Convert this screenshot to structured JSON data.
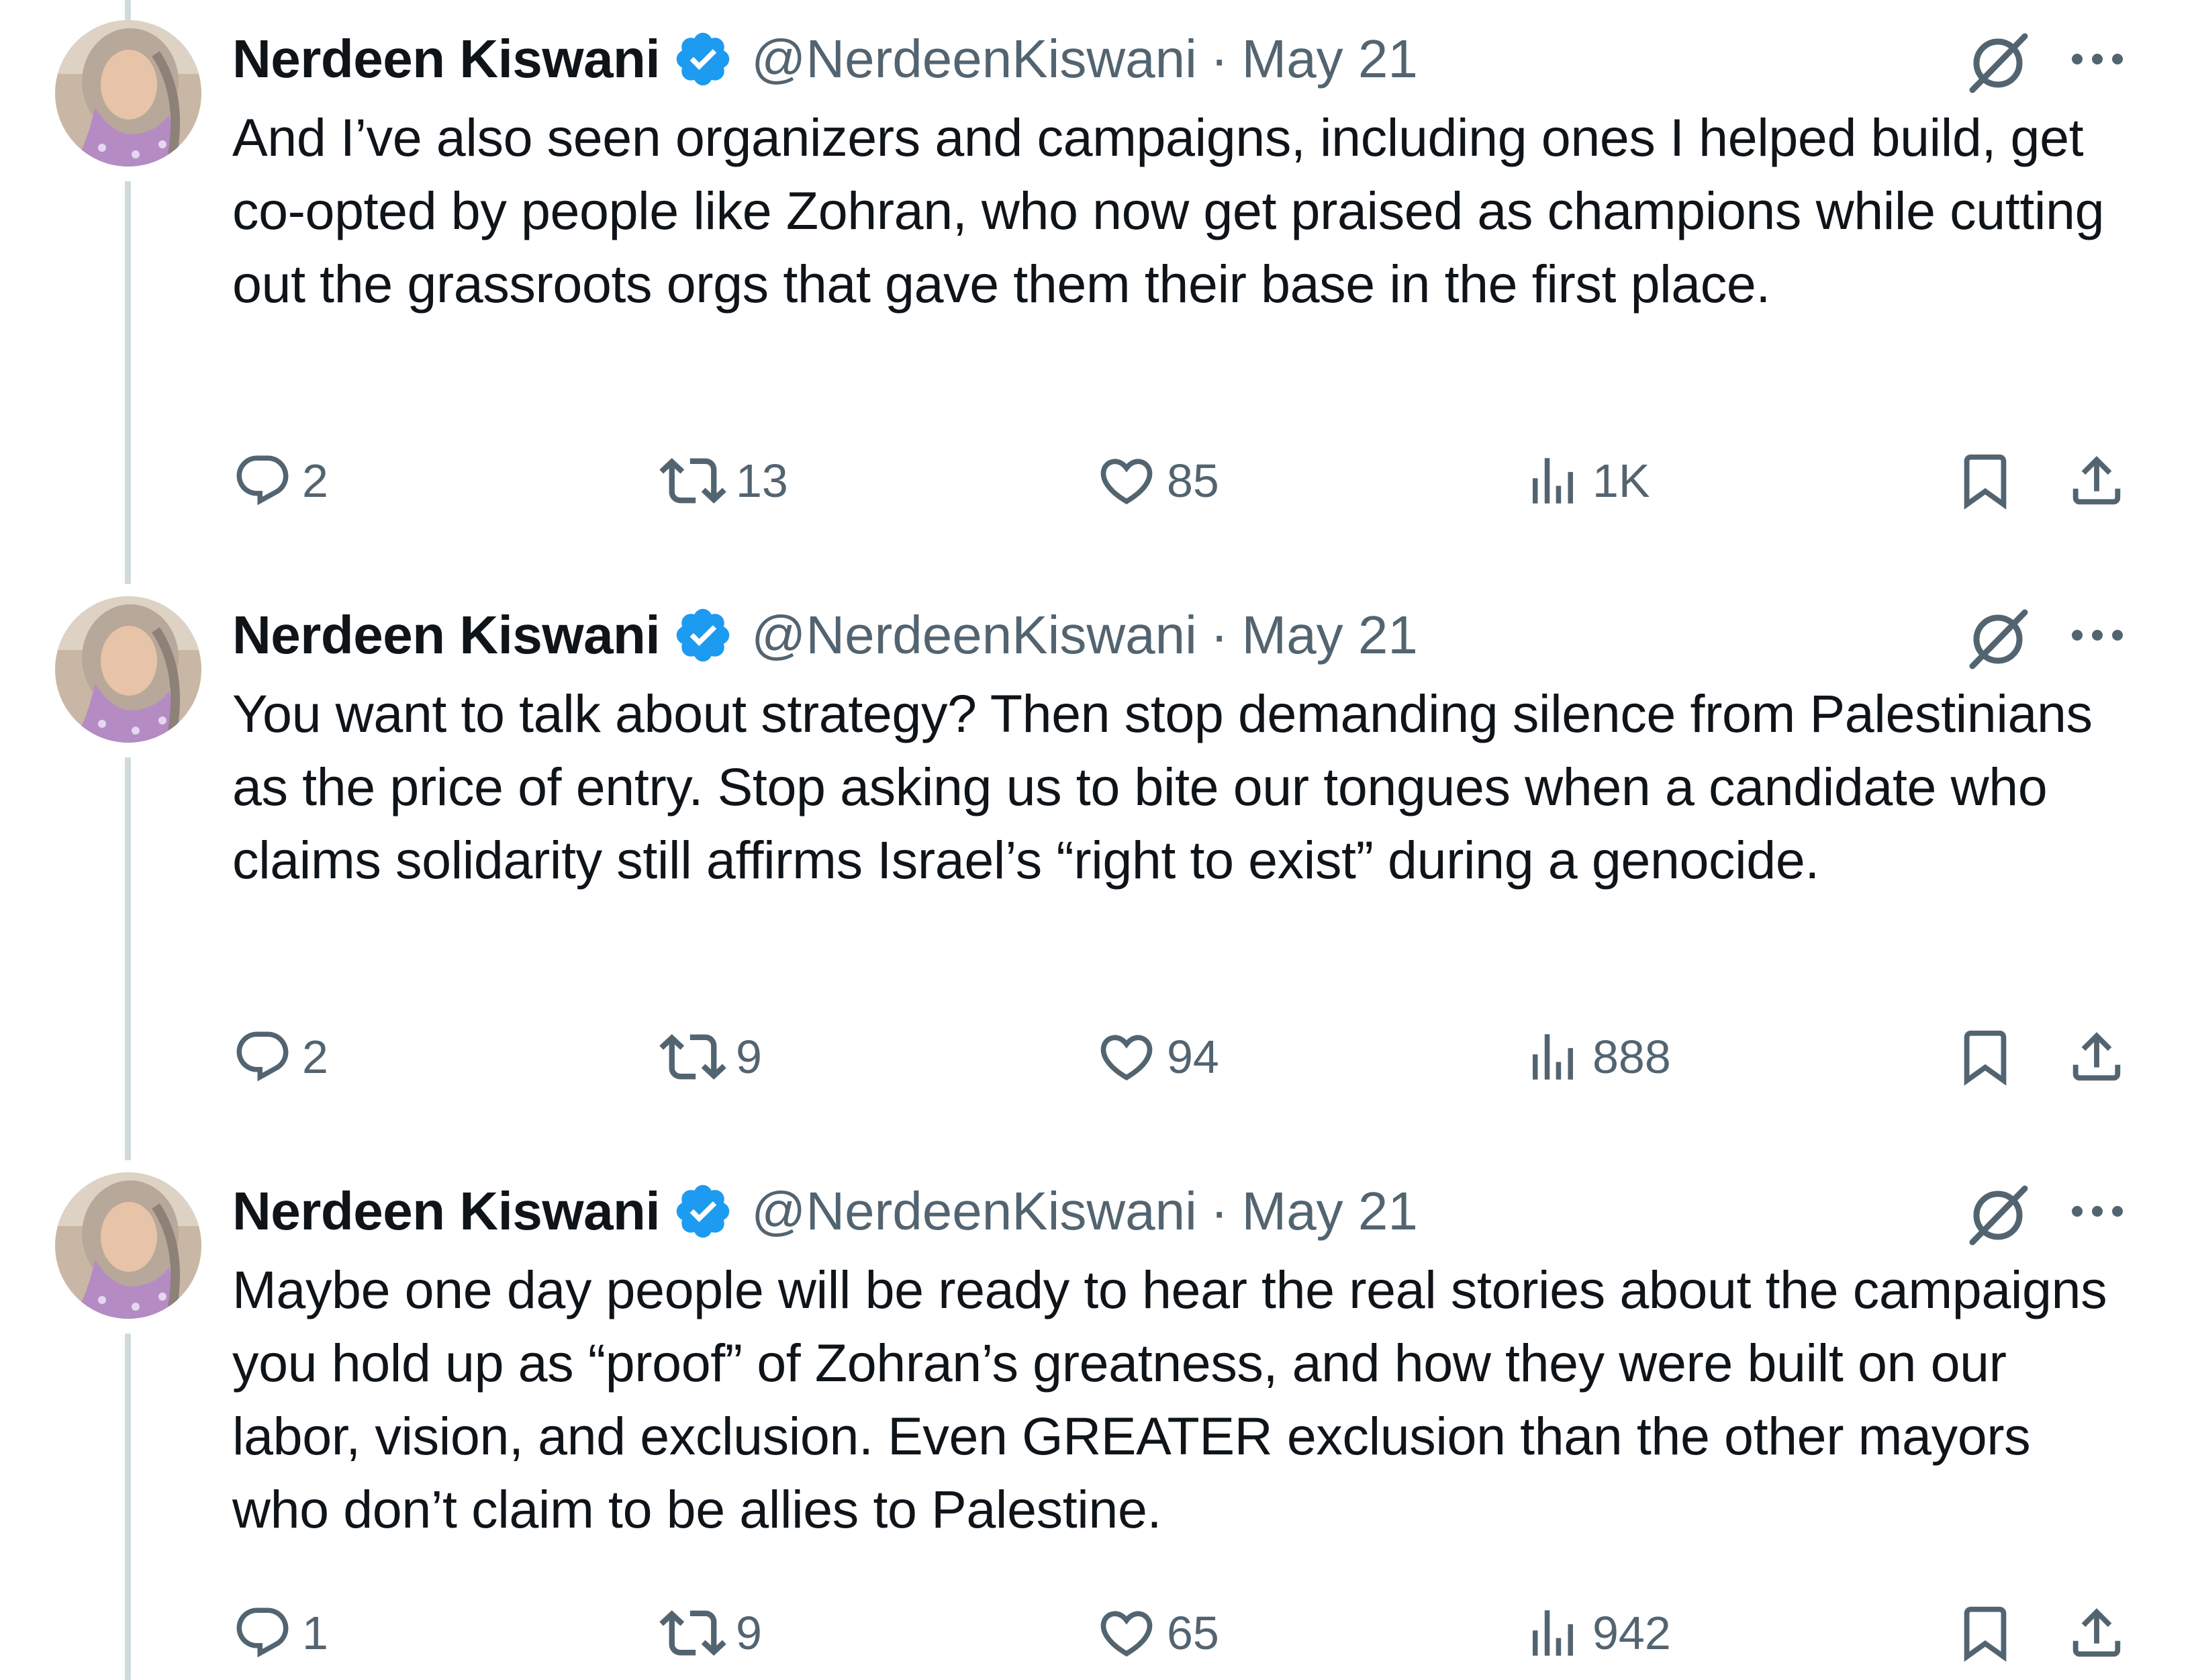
{
  "tweets": [
    {
      "author": {
        "name": "Nerdeen Kiswani",
        "handle": "@NerdeenKiswani",
        "verified": true,
        "avatar_icon": "profile-photo"
      },
      "separator": "·",
      "date": "May 21",
      "text": "And I’ve also seen organizers and campaigns, including ones I helped build, get co-opted by people like Zohran, who now get praised as champions while cutting out the grassroots orgs that gave them their base in the first place.",
      "stats": {
        "replies": "2",
        "reposts": "13",
        "likes": "85",
        "views": "1K"
      }
    },
    {
      "author": {
        "name": "Nerdeen Kiswani",
        "handle": "@NerdeenKiswani",
        "verified": true,
        "avatar_icon": "profile-photo"
      },
      "separator": "·",
      "date": "May 21",
      "text": "You want to talk about strategy? Then stop demanding silence from Palestinians as the price of entry. Stop asking us to bite our tongues when a candidate who claims solidarity still affirms Israel’s “right to exist” during a genocide.",
      "stats": {
        "replies": "2",
        "reposts": "9",
        "likes": "94",
        "views": "888"
      }
    },
    {
      "author": {
        "name": "Nerdeen Kiswani",
        "handle": "@NerdeenKiswani",
        "verified": true,
        "avatar_icon": "profile-photo"
      },
      "separator": "·",
      "date": "May 21",
      "text": "Maybe one day people will be ready to hear the real stories about the campaigns you hold up as “proof” of Zohran’s greatness, and how they were built on our labor, vision, and exclusion. Even GREATER exclusion than the other mayors who don’t claim to be allies to Palestine.",
      "stats": {
        "replies": "1",
        "reposts": "9",
        "likes": "65",
        "views": "942"
      }
    }
  ],
  "icons": {
    "verified": "verified-badge-icon",
    "grok": "grok-icon",
    "more": "more-options-icon",
    "reply": "reply-icon",
    "repost": "repost-icon",
    "like": "like-icon",
    "views": "views-icon",
    "bookmark": "bookmark-icon",
    "share": "share-icon"
  },
  "colors": {
    "verified_blue": "#1d9bf0",
    "text_primary": "#0f1419",
    "text_secondary": "#536471",
    "thread_line": "#cfd9de"
  }
}
